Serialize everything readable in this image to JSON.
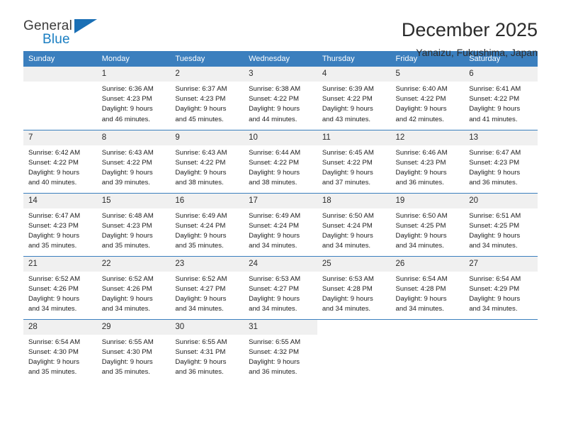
{
  "brand": {
    "word1": "General",
    "word2": "Blue",
    "logo_icon": "triangle-logo-icon",
    "accent_color": "#1a7ec2"
  },
  "header": {
    "month_title": "December 2025",
    "location": "Yanaizu, Fukushima, Japan"
  },
  "calendar": {
    "header_bg": "#3b7fbe",
    "daynum_bg": "#f0f0f0",
    "weekday_headers": [
      "Sunday",
      "Monday",
      "Tuesday",
      "Wednesday",
      "Thursday",
      "Friday",
      "Saturday"
    ],
    "weeks": [
      [
        {
          "day": "",
          "sunrise": "",
          "sunset": "",
          "daylight1": "",
          "daylight2": ""
        },
        {
          "day": "1",
          "sunrise": "Sunrise: 6:36 AM",
          "sunset": "Sunset: 4:23 PM",
          "daylight1": "Daylight: 9 hours",
          "daylight2": "and 46 minutes."
        },
        {
          "day": "2",
          "sunrise": "Sunrise: 6:37 AM",
          "sunset": "Sunset: 4:23 PM",
          "daylight1": "Daylight: 9 hours",
          "daylight2": "and 45 minutes."
        },
        {
          "day": "3",
          "sunrise": "Sunrise: 6:38 AM",
          "sunset": "Sunset: 4:22 PM",
          "daylight1": "Daylight: 9 hours",
          "daylight2": "and 44 minutes."
        },
        {
          "day": "4",
          "sunrise": "Sunrise: 6:39 AM",
          "sunset": "Sunset: 4:22 PM",
          "daylight1": "Daylight: 9 hours",
          "daylight2": "and 43 minutes."
        },
        {
          "day": "5",
          "sunrise": "Sunrise: 6:40 AM",
          "sunset": "Sunset: 4:22 PM",
          "daylight1": "Daylight: 9 hours",
          "daylight2": "and 42 minutes."
        },
        {
          "day": "6",
          "sunrise": "Sunrise: 6:41 AM",
          "sunset": "Sunset: 4:22 PM",
          "daylight1": "Daylight: 9 hours",
          "daylight2": "and 41 minutes."
        }
      ],
      [
        {
          "day": "7",
          "sunrise": "Sunrise: 6:42 AM",
          "sunset": "Sunset: 4:22 PM",
          "daylight1": "Daylight: 9 hours",
          "daylight2": "and 40 minutes."
        },
        {
          "day": "8",
          "sunrise": "Sunrise: 6:43 AM",
          "sunset": "Sunset: 4:22 PM",
          "daylight1": "Daylight: 9 hours",
          "daylight2": "and 39 minutes."
        },
        {
          "day": "9",
          "sunrise": "Sunrise: 6:43 AM",
          "sunset": "Sunset: 4:22 PM",
          "daylight1": "Daylight: 9 hours",
          "daylight2": "and 38 minutes."
        },
        {
          "day": "10",
          "sunrise": "Sunrise: 6:44 AM",
          "sunset": "Sunset: 4:22 PM",
          "daylight1": "Daylight: 9 hours",
          "daylight2": "and 38 minutes."
        },
        {
          "day": "11",
          "sunrise": "Sunrise: 6:45 AM",
          "sunset": "Sunset: 4:22 PM",
          "daylight1": "Daylight: 9 hours",
          "daylight2": "and 37 minutes."
        },
        {
          "day": "12",
          "sunrise": "Sunrise: 6:46 AM",
          "sunset": "Sunset: 4:23 PM",
          "daylight1": "Daylight: 9 hours",
          "daylight2": "and 36 minutes."
        },
        {
          "day": "13",
          "sunrise": "Sunrise: 6:47 AM",
          "sunset": "Sunset: 4:23 PM",
          "daylight1": "Daylight: 9 hours",
          "daylight2": "and 36 minutes."
        }
      ],
      [
        {
          "day": "14",
          "sunrise": "Sunrise: 6:47 AM",
          "sunset": "Sunset: 4:23 PM",
          "daylight1": "Daylight: 9 hours",
          "daylight2": "and 35 minutes."
        },
        {
          "day": "15",
          "sunrise": "Sunrise: 6:48 AM",
          "sunset": "Sunset: 4:23 PM",
          "daylight1": "Daylight: 9 hours",
          "daylight2": "and 35 minutes."
        },
        {
          "day": "16",
          "sunrise": "Sunrise: 6:49 AM",
          "sunset": "Sunset: 4:24 PM",
          "daylight1": "Daylight: 9 hours",
          "daylight2": "and 35 minutes."
        },
        {
          "day": "17",
          "sunrise": "Sunrise: 6:49 AM",
          "sunset": "Sunset: 4:24 PM",
          "daylight1": "Daylight: 9 hours",
          "daylight2": "and 34 minutes."
        },
        {
          "day": "18",
          "sunrise": "Sunrise: 6:50 AM",
          "sunset": "Sunset: 4:24 PM",
          "daylight1": "Daylight: 9 hours",
          "daylight2": "and 34 minutes."
        },
        {
          "day": "19",
          "sunrise": "Sunrise: 6:50 AM",
          "sunset": "Sunset: 4:25 PM",
          "daylight1": "Daylight: 9 hours",
          "daylight2": "and 34 minutes."
        },
        {
          "day": "20",
          "sunrise": "Sunrise: 6:51 AM",
          "sunset": "Sunset: 4:25 PM",
          "daylight1": "Daylight: 9 hours",
          "daylight2": "and 34 minutes."
        }
      ],
      [
        {
          "day": "21",
          "sunrise": "Sunrise: 6:52 AM",
          "sunset": "Sunset: 4:26 PM",
          "daylight1": "Daylight: 9 hours",
          "daylight2": "and 34 minutes."
        },
        {
          "day": "22",
          "sunrise": "Sunrise: 6:52 AM",
          "sunset": "Sunset: 4:26 PM",
          "daylight1": "Daylight: 9 hours",
          "daylight2": "and 34 minutes."
        },
        {
          "day": "23",
          "sunrise": "Sunrise: 6:52 AM",
          "sunset": "Sunset: 4:27 PM",
          "daylight1": "Daylight: 9 hours",
          "daylight2": "and 34 minutes."
        },
        {
          "day": "24",
          "sunrise": "Sunrise: 6:53 AM",
          "sunset": "Sunset: 4:27 PM",
          "daylight1": "Daylight: 9 hours",
          "daylight2": "and 34 minutes."
        },
        {
          "day": "25",
          "sunrise": "Sunrise: 6:53 AM",
          "sunset": "Sunset: 4:28 PM",
          "daylight1": "Daylight: 9 hours",
          "daylight2": "and 34 minutes."
        },
        {
          "day": "26",
          "sunrise": "Sunrise: 6:54 AM",
          "sunset": "Sunset: 4:28 PM",
          "daylight1": "Daylight: 9 hours",
          "daylight2": "and 34 minutes."
        },
        {
          "day": "27",
          "sunrise": "Sunrise: 6:54 AM",
          "sunset": "Sunset: 4:29 PM",
          "daylight1": "Daylight: 9 hours",
          "daylight2": "and 34 minutes."
        }
      ],
      [
        {
          "day": "28",
          "sunrise": "Sunrise: 6:54 AM",
          "sunset": "Sunset: 4:30 PM",
          "daylight1": "Daylight: 9 hours",
          "daylight2": "and 35 minutes."
        },
        {
          "day": "29",
          "sunrise": "Sunrise: 6:55 AM",
          "sunset": "Sunset: 4:30 PM",
          "daylight1": "Daylight: 9 hours",
          "daylight2": "and 35 minutes."
        },
        {
          "day": "30",
          "sunrise": "Sunrise: 6:55 AM",
          "sunset": "Sunset: 4:31 PM",
          "daylight1": "Daylight: 9 hours",
          "daylight2": "and 36 minutes."
        },
        {
          "day": "31",
          "sunrise": "Sunrise: 6:55 AM",
          "sunset": "Sunset: 4:32 PM",
          "daylight1": "Daylight: 9 hours",
          "daylight2": "and 36 minutes."
        },
        {
          "day": "",
          "sunrise": "",
          "sunset": "",
          "daylight1": "",
          "daylight2": ""
        },
        {
          "day": "",
          "sunrise": "",
          "sunset": "",
          "daylight1": "",
          "daylight2": ""
        },
        {
          "day": "",
          "sunrise": "",
          "sunset": "",
          "daylight1": "",
          "daylight2": ""
        }
      ]
    ]
  }
}
